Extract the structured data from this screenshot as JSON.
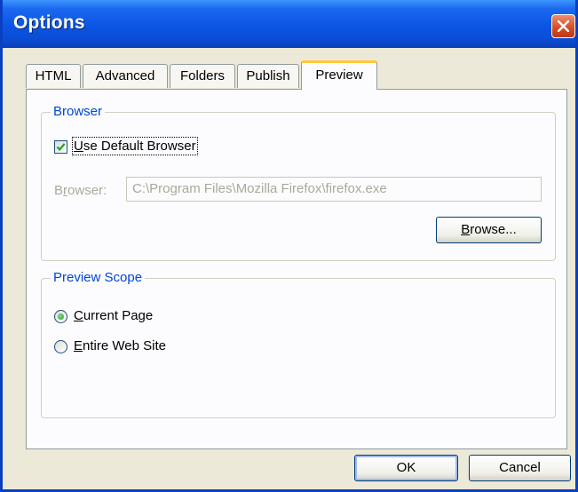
{
  "window": {
    "title": "Options"
  },
  "tabs": [
    {
      "label": "HTML",
      "active": false
    },
    {
      "label": "Advanced",
      "active": false
    },
    {
      "label": "Folders",
      "active": false
    },
    {
      "label": "Publish",
      "active": false
    },
    {
      "label": "Preview",
      "active": true
    }
  ],
  "browser_group": {
    "legend": "Browser",
    "use_default": {
      "checked": true,
      "label_underline": "U",
      "label_rest": "se Default Browser"
    },
    "field_label_pre": "B",
    "field_label_underline": "r",
    "field_label_post": "owser:",
    "path_value": "C:\\Program Files\\Mozilla Firefox\\firefox.exe",
    "browse_underline": "B",
    "browse_rest": "rowse..."
  },
  "scope_group": {
    "legend": "Preview Scope",
    "options": [
      {
        "underline": "C",
        "rest": "urrent Page",
        "selected": true
      },
      {
        "underline": "E",
        "rest": "ntire Web Site",
        "selected": false
      }
    ]
  },
  "footer": {
    "ok_label": "OK",
    "cancel_label": "Cancel"
  },
  "colors": {
    "titlebar": "#0a55e4",
    "group_legend": "#0046d5",
    "active_tab_highlight": "#ffc83c",
    "close_button": "#d44a22"
  },
  "icons": [
    "close-icon",
    "checkmark-icon",
    "radio-dot-icon"
  ]
}
